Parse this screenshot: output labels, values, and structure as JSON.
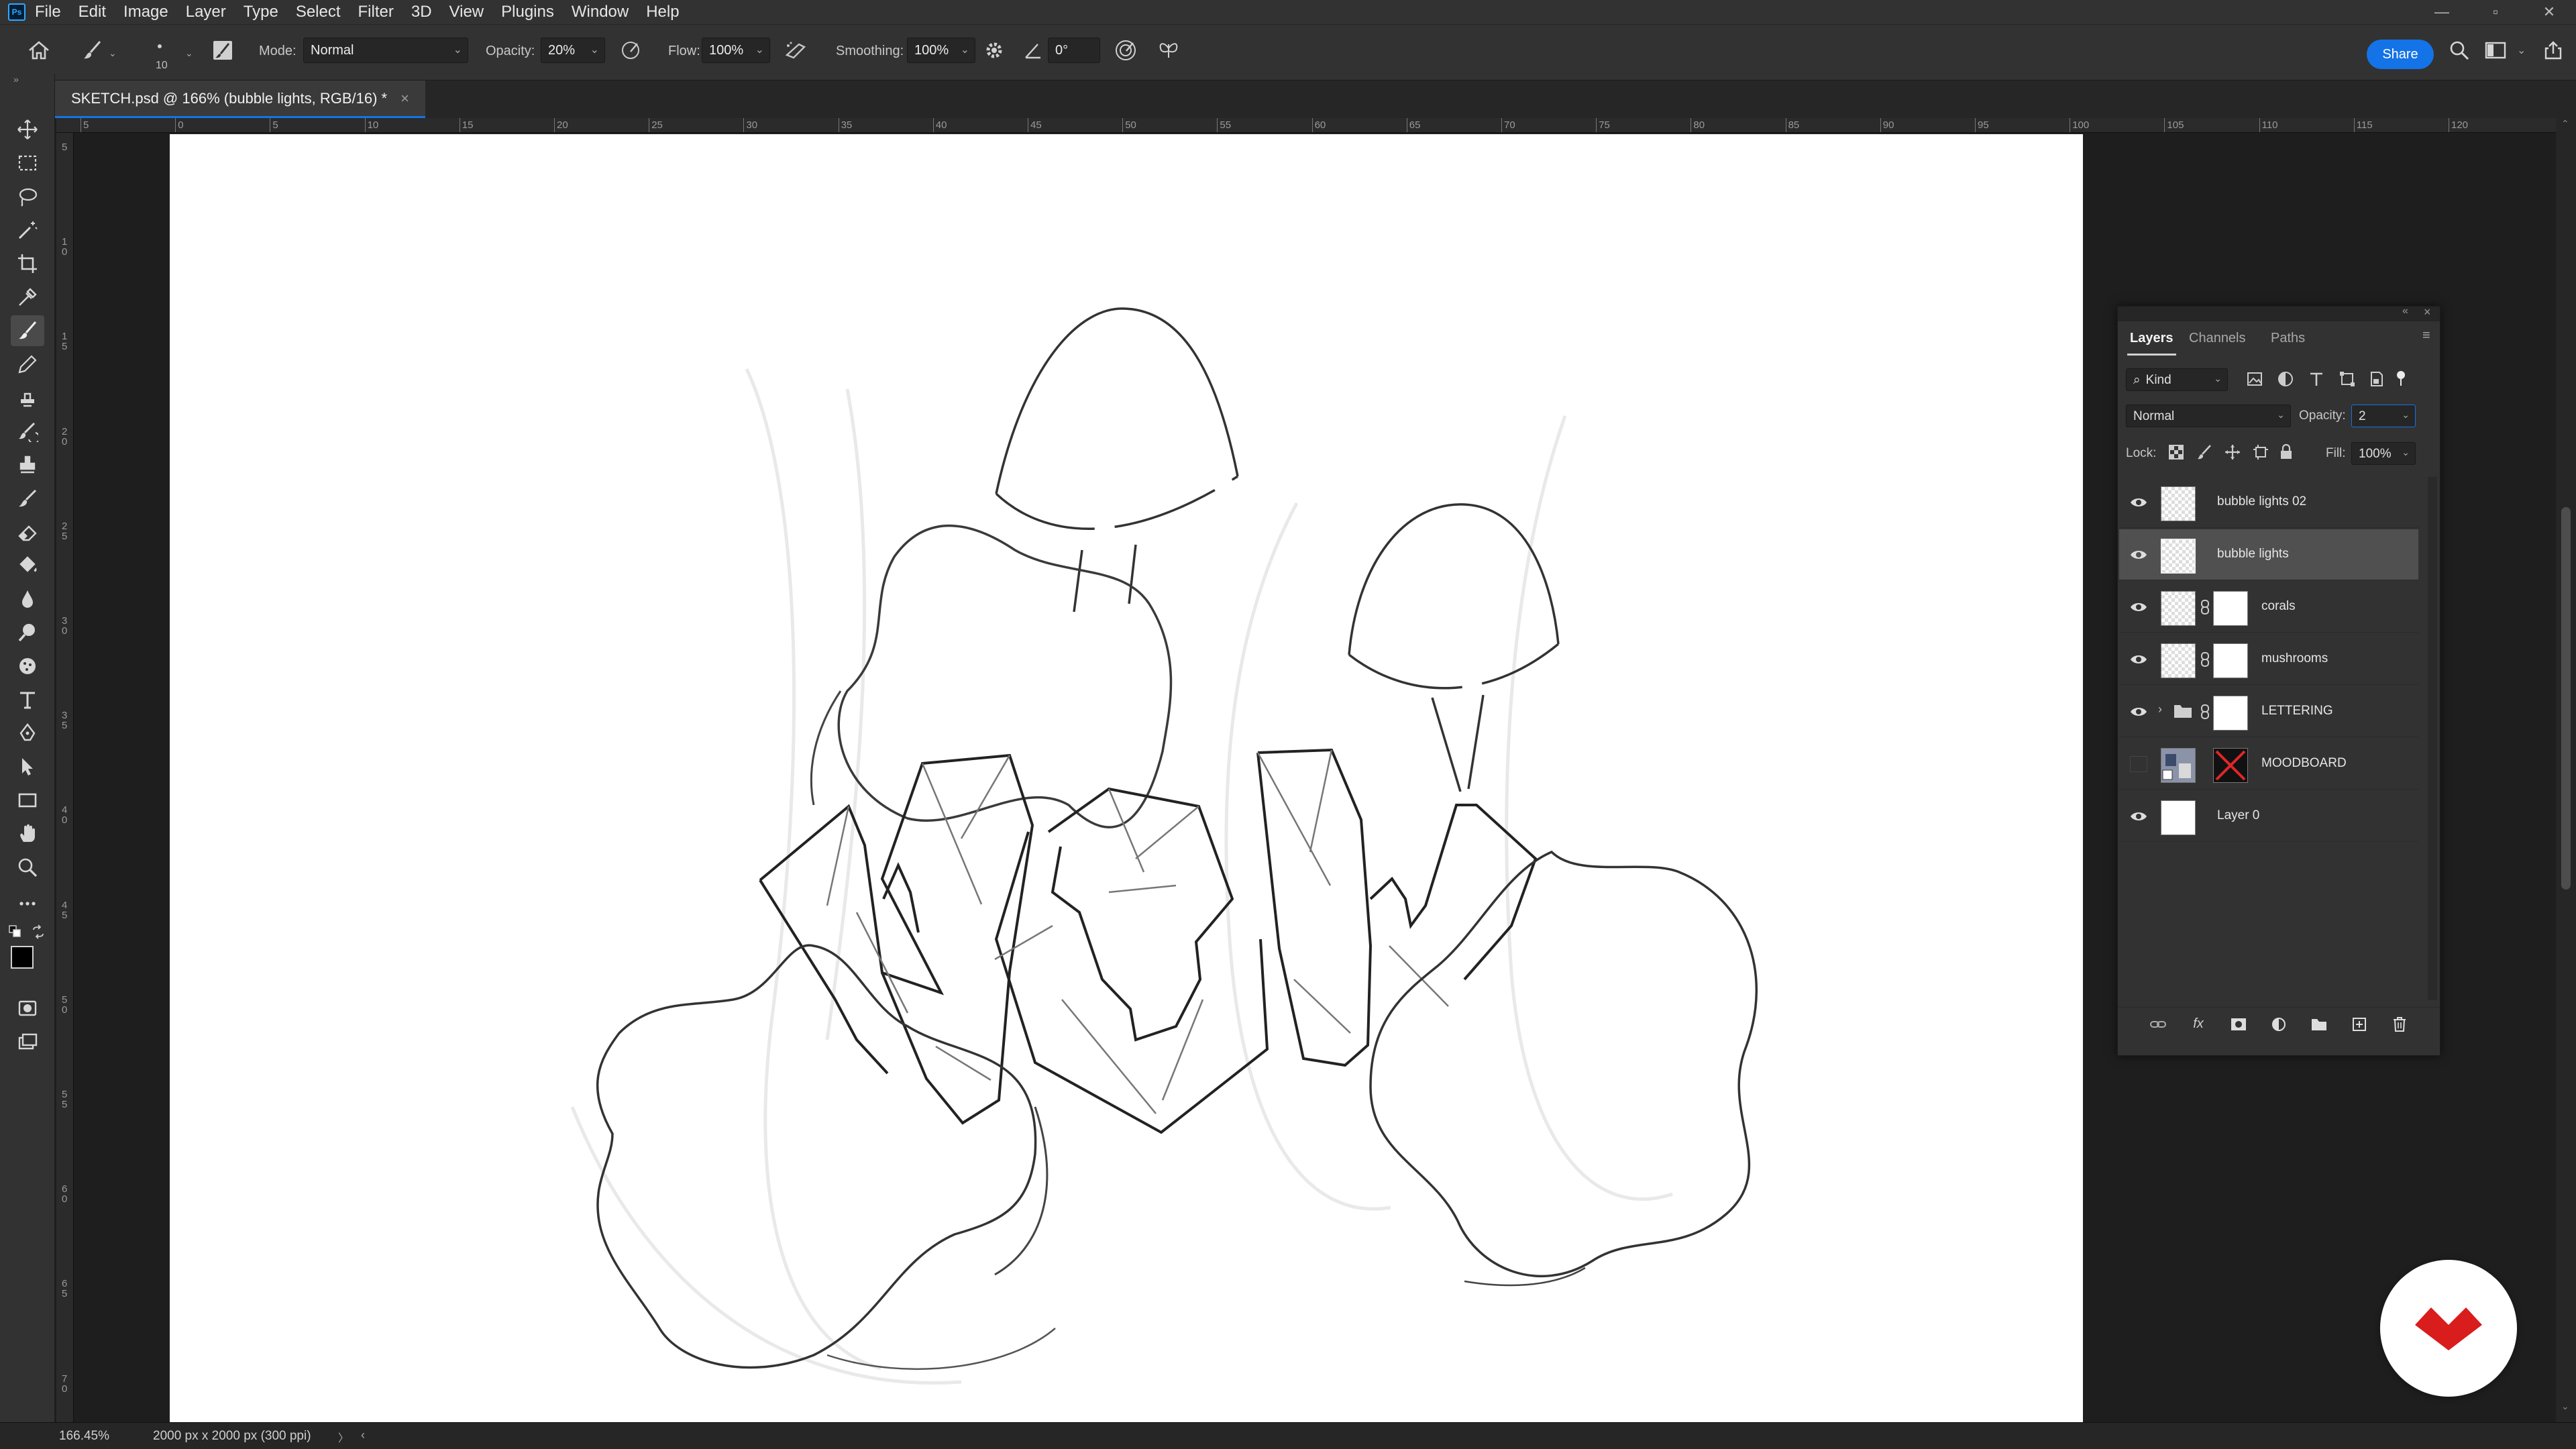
{
  "app": {
    "logo_text": "Ps",
    "menu": [
      "File",
      "Edit",
      "Image",
      "Layer",
      "Type",
      "Select",
      "Filter",
      "3D",
      "View",
      "Plugins",
      "Window",
      "Help"
    ]
  },
  "options_bar": {
    "brush_size": "10",
    "mode_label": "Mode:",
    "mode_value": "Normal",
    "opacity_label": "Opacity:",
    "opacity_value": "20%",
    "flow_label": "Flow:",
    "flow_value": "100%",
    "smoothing_label": "Smoothing:",
    "smoothing_value": "100%",
    "angle_value": "0°",
    "share_label": "Share"
  },
  "document": {
    "tab_title": "SKETCH.psd @ 166% (bubble lights, RGB/16) *",
    "close_glyph": "×"
  },
  "ruler": {
    "horizontal": [
      "5",
      "0",
      "5",
      "10",
      "15",
      "20",
      "25",
      "30",
      "35",
      "40",
      "45",
      "50",
      "55",
      "60",
      "65",
      "70",
      "75",
      "80",
      "85",
      "90",
      "95",
      "100",
      "105",
      "110",
      "115",
      "120"
    ],
    "vertical": [
      "5",
      "1\n0",
      "1\n5",
      "2\n0",
      "2\n5",
      "3\n0",
      "3\n5",
      "4\n0",
      "4\n5",
      "5\n0",
      "5\n5",
      "6\n0",
      "6\n5",
      "7\n0"
    ]
  },
  "status": {
    "zoom": "166.45%",
    "doc_info": "2000 px x 2000 px (300 ppi)",
    "arrow": "〉"
  },
  "layers_panel": {
    "tabs": [
      "Layers",
      "Channels",
      "Paths"
    ],
    "active_tab": "Layers",
    "filter_kind": "Kind",
    "blend_mode": "Normal",
    "opacity_label": "Opacity:",
    "opacity_value": "2",
    "lock_label": "Lock:",
    "fill_label": "Fill:",
    "fill_value": "100%",
    "layers": [
      {
        "name": "bubble lights 02",
        "visible": true,
        "selected": false,
        "type": "pixel"
      },
      {
        "name": "bubble lights",
        "visible": true,
        "selected": true,
        "type": "pixel"
      },
      {
        "name": "corals",
        "visible": true,
        "selected": false,
        "type": "masked"
      },
      {
        "name": "mushrooms",
        "visible": true,
        "selected": false,
        "type": "masked"
      },
      {
        "name": "LETTERING",
        "visible": true,
        "selected": false,
        "type": "group"
      },
      {
        "name": "MOODBOARD",
        "visible": false,
        "selected": false,
        "type": "smart-masked"
      },
      {
        "name": "Layer 0",
        "visible": true,
        "selected": false,
        "type": "background"
      }
    ]
  },
  "colors": {
    "accent": "#1473e6",
    "brand_red": "#d91c1c",
    "panel_bg": "#323232",
    "app_bg": "#1e1e1e"
  }
}
